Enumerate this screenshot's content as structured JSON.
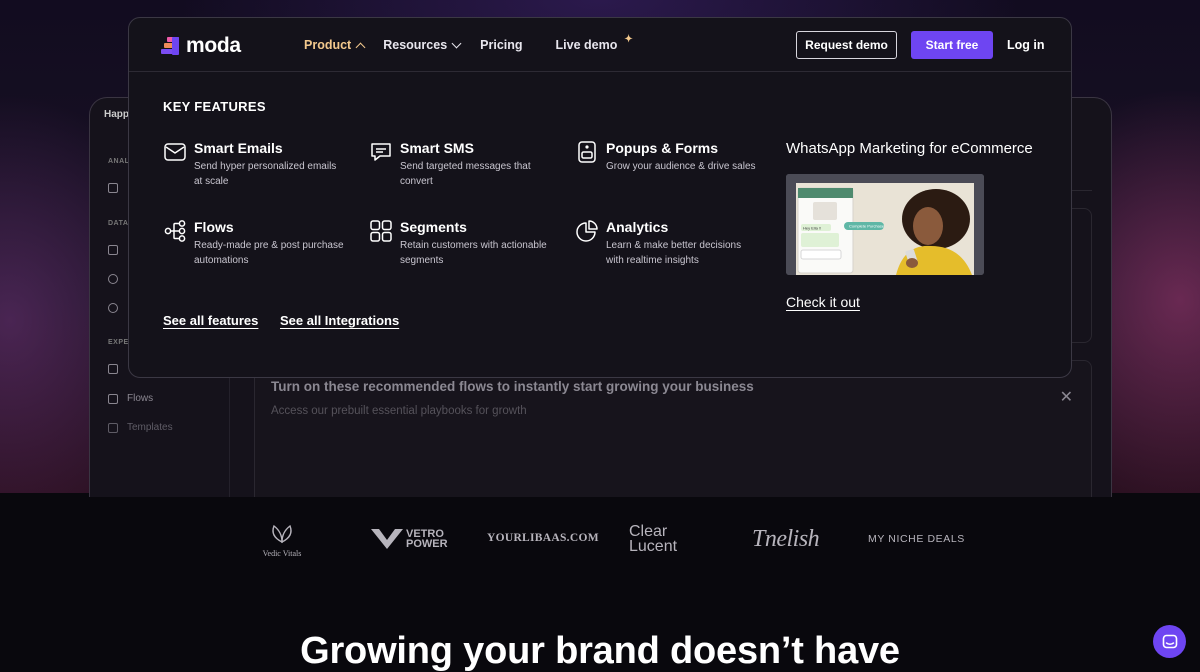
{
  "header": {
    "logo_text": "moda",
    "nav": [
      {
        "label": "Product",
        "active": true
      },
      {
        "label": "Resources",
        "active": false
      },
      {
        "label": "Pricing",
        "active": false
      },
      {
        "label": "Live demo",
        "active": false
      }
    ],
    "request_demo_label": "Request demo",
    "start_free_label": "Start free",
    "login_label": "Log in"
  },
  "dropdown": {
    "section_title": "KEY FEATURES",
    "features": [
      {
        "title": "Smart Emails",
        "desc": "Send hyper personalized emails at scale",
        "icon": "email-icon"
      },
      {
        "title": "Smart SMS",
        "desc": "Send targeted messages that convert",
        "icon": "sms-icon"
      },
      {
        "title": "Popups & Forms",
        "desc": "Grow your audience & drive sales",
        "icon": "popup-icon"
      },
      {
        "title": "Flows",
        "desc": "Ready-made pre & post purchase automations",
        "icon": "flows-icon"
      },
      {
        "title": "Segments",
        "desc": "Retain customers with actionable segments",
        "icon": "segments-icon"
      },
      {
        "title": "Analytics",
        "desc": "Learn & make better decisions with realtime insights",
        "icon": "analytics-icon"
      }
    ],
    "see_all_features": "See all features",
    "see_all_integrations": "See all Integrations",
    "promo": {
      "title": "WhatsApp Marketing for eCommerce",
      "cta": "Check it out",
      "chat_bubble_1": "Hey Ella !!",
      "chat_bubble_2": "Complete Purchase"
    }
  },
  "app_preview": {
    "brand": "Happ",
    "sections": [
      "ANAL",
      "DATA",
      "EXPER"
    ],
    "items": [
      "Flows",
      "Templates"
    ],
    "panel_title": "Turn on these recommended flows to instantly start growing your business",
    "panel_subtitle": "Access our prebuilt essential playbooks for growth"
  },
  "brands": {
    "vedic": "Vedic Vitals",
    "vetro_top": "VETRO",
    "vetro_bottom": "POWER",
    "yourlibaas": "YOURLIBAAS.COM",
    "clear": "Clear",
    "lucent": "Lucent",
    "tnelish": "Tnelish",
    "niche": "MY NICHE DEALS"
  },
  "headline": "Growing your brand doesn’t have",
  "colors": {
    "accent": "#6e45f2",
    "active_nav": "#f4c98d",
    "panel_bg": "#14121a"
  }
}
